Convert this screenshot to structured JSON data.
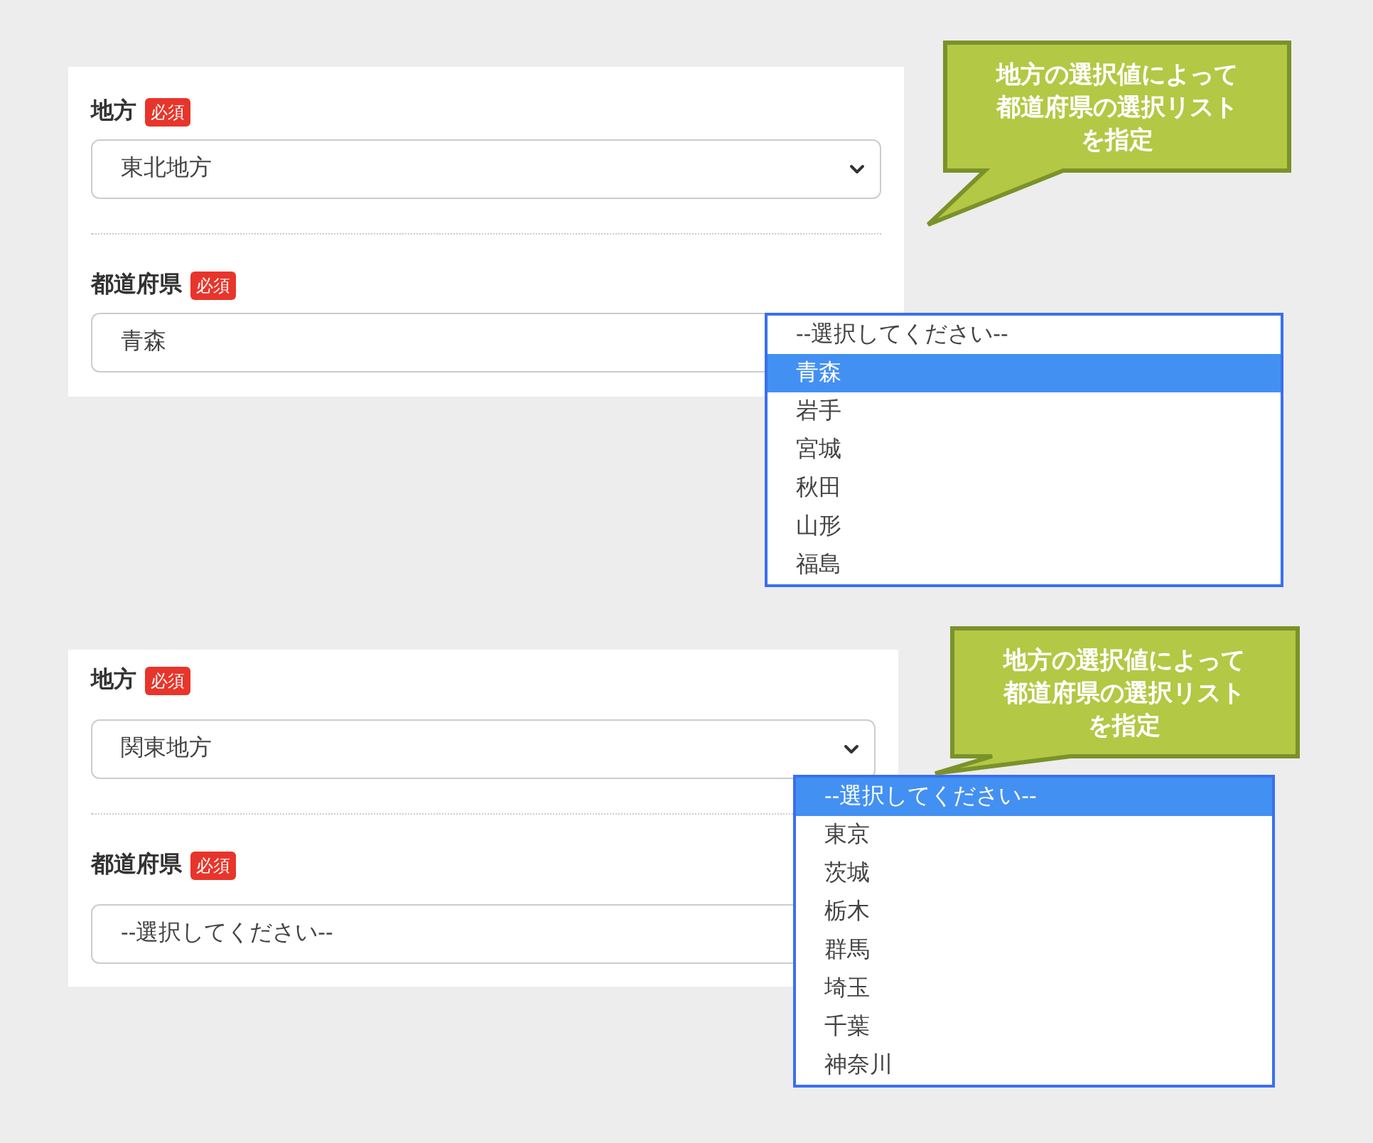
{
  "sections": [
    {
      "fields": [
        {
          "label": "地方",
          "badge": "必須",
          "value": "東北地方",
          "open": false
        },
        {
          "label": "都道府県",
          "badge": "必須",
          "value": "青森",
          "open": true,
          "options": [
            {
              "text": "--選択してください--",
              "selected": false
            },
            {
              "text": "青森",
              "selected": true
            },
            {
              "text": "岩手",
              "selected": false
            },
            {
              "text": "宮城",
              "selected": false
            },
            {
              "text": "秋田",
              "selected": false
            },
            {
              "text": "山形",
              "selected": false
            },
            {
              "text": "福島",
              "selected": false
            }
          ]
        }
      ],
      "callout": [
        "地方の選択値によって",
        "都道府県の選択リスト",
        "を指定"
      ]
    },
    {
      "fields": [
        {
          "label": "地方",
          "badge": "必須",
          "value": "関東地方",
          "open": false
        },
        {
          "label": "都道府県",
          "badge": "必須",
          "value": "--選択してください--",
          "open": true,
          "options": [
            {
              "text": "--選択してください--",
              "selected": true
            },
            {
              "text": "東京",
              "selected": false
            },
            {
              "text": "茨城",
              "selected": false
            },
            {
              "text": "栃木",
              "selected": false
            },
            {
              "text": "群馬",
              "selected": false
            },
            {
              "text": "埼玉",
              "selected": false
            },
            {
              "text": "千葉",
              "selected": false
            },
            {
              "text": "神奈川",
              "selected": false
            }
          ]
        }
      ],
      "callout": [
        "地方の選択値によって",
        "都道府県の選択リスト",
        "を指定"
      ]
    }
  ]
}
